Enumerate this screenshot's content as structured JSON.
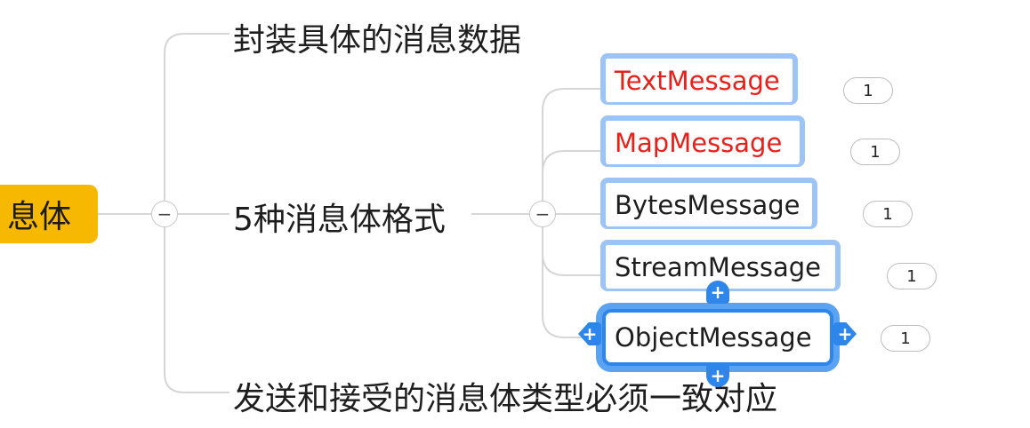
{
  "root": {
    "label": "息体"
  },
  "topics": [
    {
      "label": "封装具体的消息数据"
    },
    {
      "label": "5种消息体格式"
    },
    {
      "label": "发送和接受的消息体类型必须一致对应"
    }
  ],
  "collapse_symbol": "−",
  "messages": [
    {
      "label": "TextMessage",
      "color": "#e8201a",
      "count": "1"
    },
    {
      "label": "MapMessage",
      "color": "#e8201a",
      "count": "1"
    },
    {
      "label": "BytesMessage",
      "color": "#1e1e1e",
      "count": "1"
    },
    {
      "label": "StreamMessage",
      "color": "#1e1e1e",
      "count": "1"
    },
    {
      "label": "ObjectMessage",
      "color": "#1e1e1e",
      "count": "1"
    }
  ],
  "handle_symbol": "+",
  "colors": {
    "root_fill": "#f6b800",
    "selection": "#2f86ea",
    "node_border": "#9cc4f7",
    "connector": "#d4d4d4"
  }
}
